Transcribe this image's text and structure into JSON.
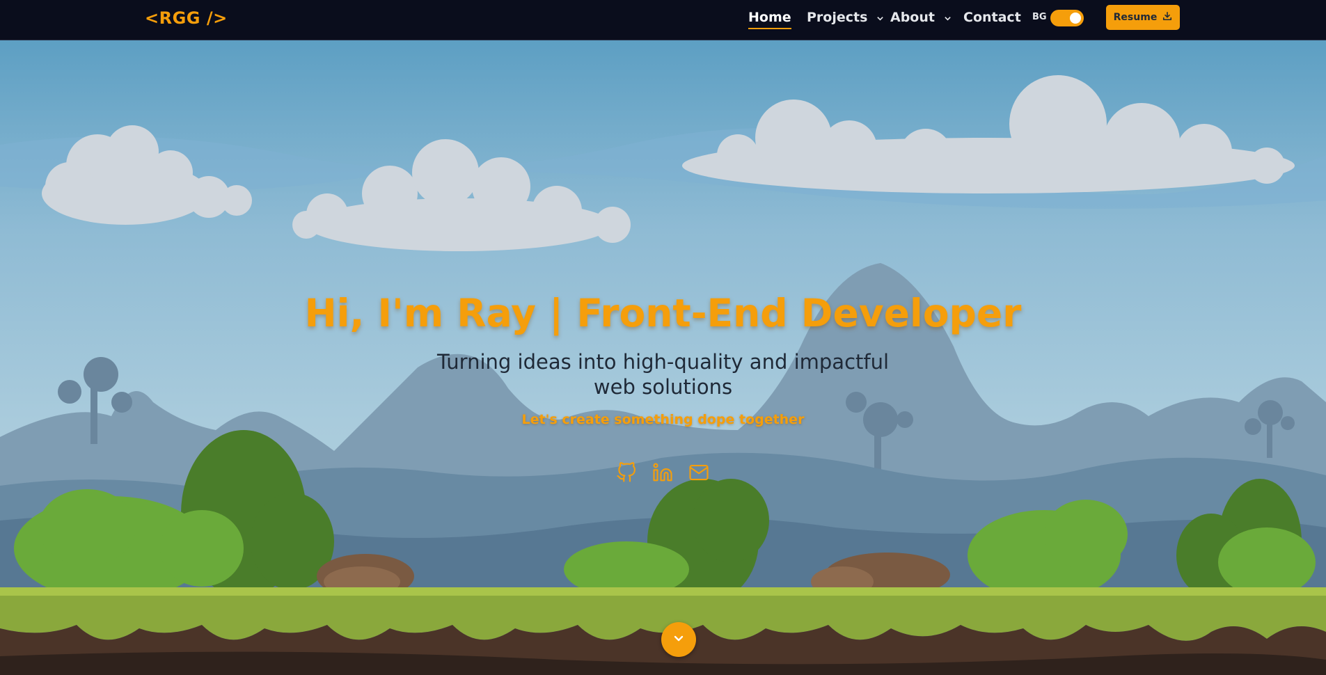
{
  "nav": {
    "logo": "<RGG />",
    "items": [
      {
        "label": "Home",
        "active": true
      },
      {
        "label": "Projects",
        "dropdown": true
      },
      {
        "label": "About",
        "dropdown": true
      },
      {
        "label": "Contact"
      }
    ],
    "bg_toggle_label": "BG",
    "bg_toggle_on": true,
    "resume_label": "Resume",
    "resume_icon": "download-icon"
  },
  "hero": {
    "title": "Hi, I'm Ray | Front-End Developer",
    "subtitle": "Turning ideas into high-quality and impactful web solutions",
    "tagline": "Let's create something dope together",
    "socials": [
      {
        "icon": "github-icon"
      },
      {
        "icon": "linkedin-icon"
      },
      {
        "icon": "mail-icon"
      }
    ],
    "scroll_icon": "chevron-down-icon"
  },
  "colors": {
    "accent": "#f59e0b",
    "nav_bg": "#0a0d1c",
    "sky_top": "#5b9ec4",
    "grass": "#8ab23a",
    "soil": "#4a3428"
  }
}
